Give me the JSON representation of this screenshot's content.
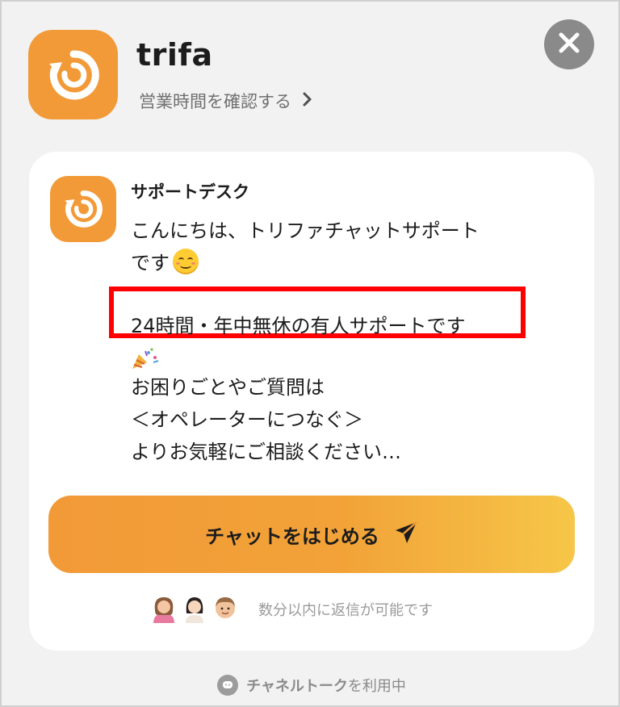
{
  "header": {
    "brand_name": "trifa",
    "hours_link_label": "営業時間を確認する",
    "hours_link_icon": "chevron-right-icon",
    "close_icon": "close-icon",
    "logo_icon": "trifa-logo-icon",
    "logo_color": "#f29a38"
  },
  "card": {
    "agent_name": "サポートデスク",
    "agent_avatar_icon": "trifa-logo-icon",
    "message": {
      "line1": "こんにちは、トリファチャットサポート",
      "line2": "です",
      "line2_emoji": "smiling-face-icon",
      "line3": "24時間・年中無休の有人サポートです",
      "line4_emoji": "party-popper-icon",
      "line5": "お困りごとやご質問は",
      "line6": "＜オペレーターにつなぐ＞",
      "line7": "よりお気軽にご相談ください…"
    },
    "start_button_label": "チャットをはじめる",
    "start_button_icon": "send-icon",
    "reply_time_text": "数分以内に返信が可能です",
    "member_avatars": [
      "member-avatar-1",
      "member-avatar-2",
      "member-avatar-3"
    ]
  },
  "footer": {
    "brand_label": "チャネルトーク",
    "suffix_label": "を利用中",
    "icon": "channel-talk-icon"
  },
  "colors": {
    "accent": "#f29a38",
    "accent_end": "#f6c648",
    "highlight_border": "#ff0000",
    "background": "#f2f2f2",
    "card": "#ffffff"
  }
}
